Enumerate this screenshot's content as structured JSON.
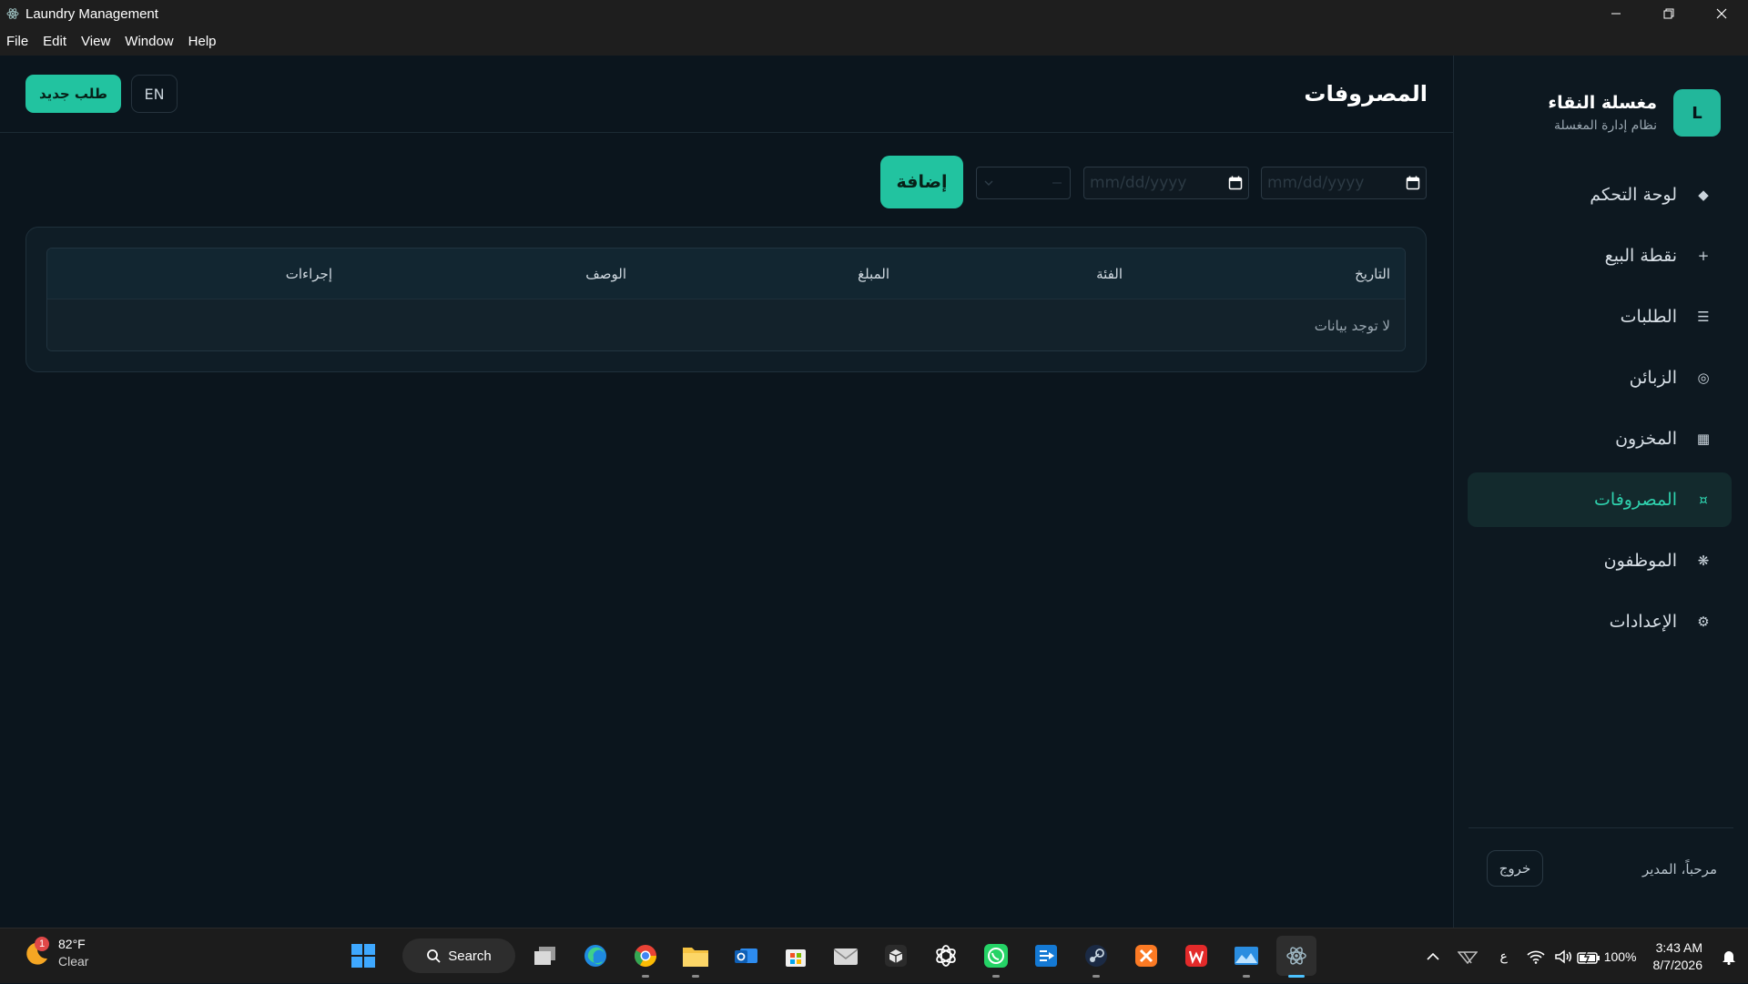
{
  "window": {
    "title": "Laundry Management",
    "menu": [
      "File",
      "Edit",
      "View",
      "Window",
      "Help"
    ]
  },
  "sidebar": {
    "brand_initial": "L",
    "brand_name": "مغسلة النقاء",
    "brand_subtitle": "نظام إدارة المغسلة",
    "items": [
      {
        "label": "لوحة التحكم",
        "icon": "diamond-icon"
      },
      {
        "label": "نقطة البيع",
        "icon": "plus-icon"
      },
      {
        "label": "الطلبات",
        "icon": "list-icon"
      },
      {
        "label": "الزبائن",
        "icon": "target-icon"
      },
      {
        "label": "المخزون",
        "icon": "grid-icon"
      },
      {
        "label": "المصروفات",
        "icon": "currency-icon",
        "active": true
      },
      {
        "label": "الموظفون",
        "icon": "asterisk-icon"
      },
      {
        "label": "الإعدادات",
        "icon": "gear-icon"
      }
    ],
    "welcome": "مرحباً، المدير",
    "logout_label": "خروج"
  },
  "header": {
    "title": "المصروفات",
    "new_order_label": "طلب جديد",
    "lang_label": "EN"
  },
  "toolbar": {
    "date_from_placeholder": "mm/dd/yyyy",
    "date_to_placeholder": "mm/dd/yyyy",
    "category_value": "",
    "add_label": "إضافة"
  },
  "table": {
    "columns": [
      "التاريخ",
      "الفئة",
      "المبلغ",
      "الوصف",
      "إجراءات"
    ],
    "empty_text": "لا توجد بيانات"
  },
  "taskbar": {
    "weather_badge": "1",
    "weather_temp": "82°F",
    "weather_condition": "Clear",
    "search_label": "Search",
    "input_indicator": "ع",
    "battery": "100%",
    "time": "3:43 AM",
    "date": "8/7/2026"
  },
  "colors": {
    "accent": "#22c3a0",
    "background": "#0b151d",
    "sidebar": "#0d1820",
    "active_nav": "#132a2d"
  }
}
